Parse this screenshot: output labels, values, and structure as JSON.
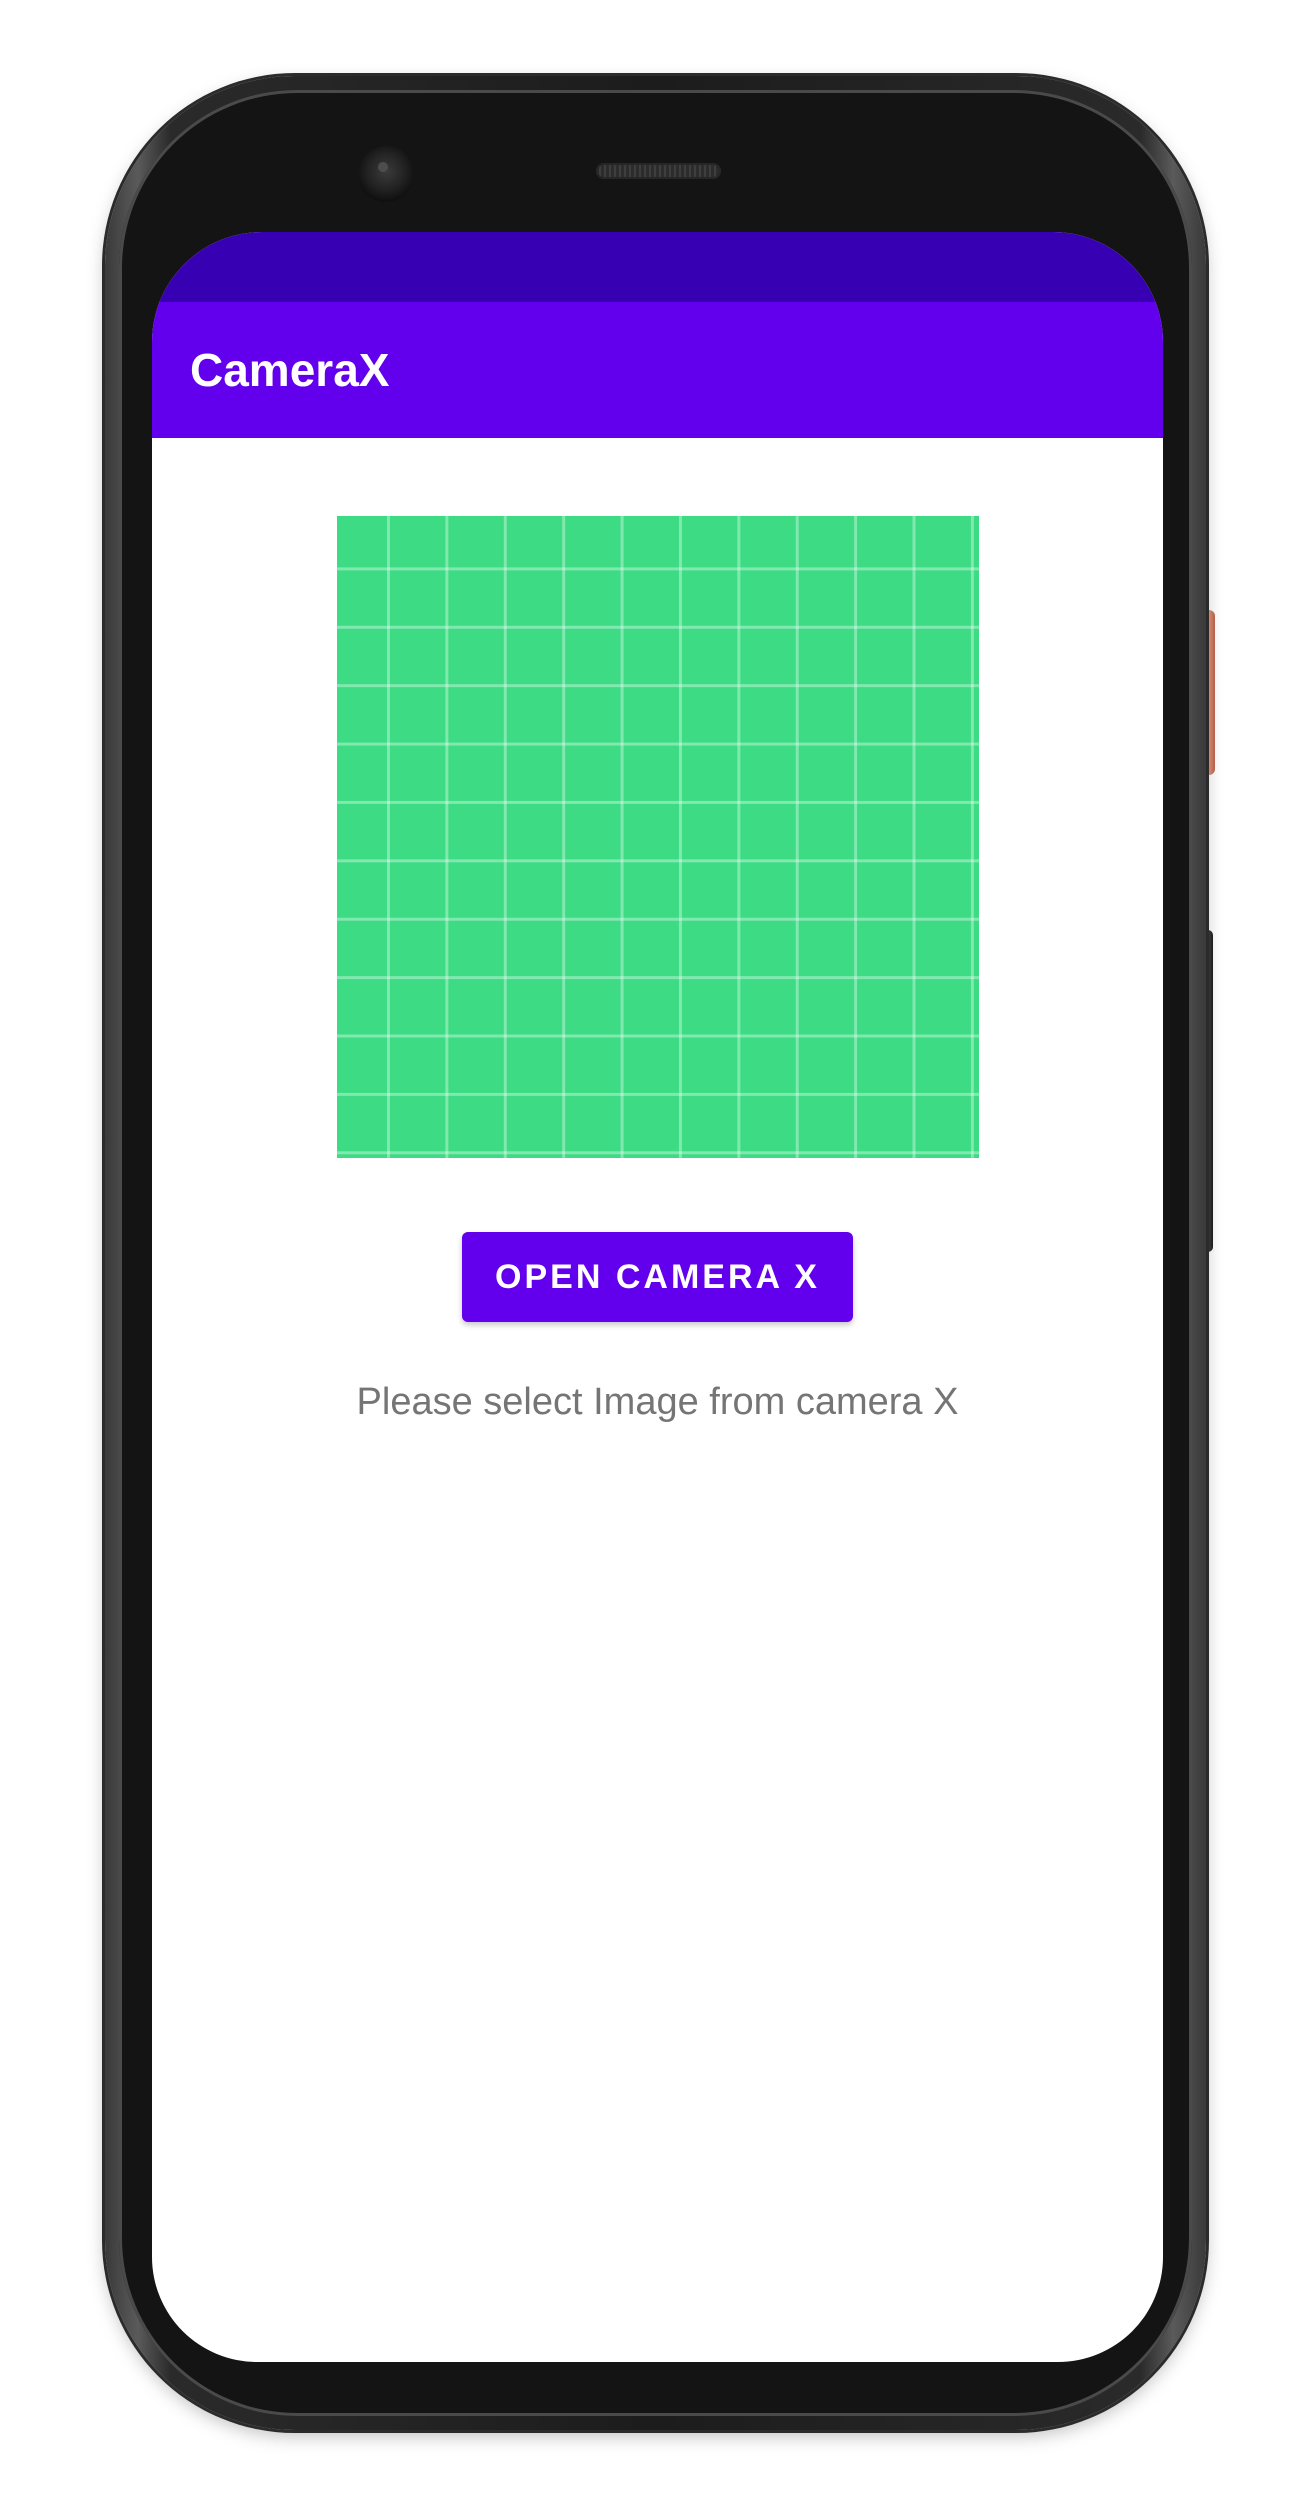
{
  "app_bar": {
    "title": "CameraX"
  },
  "main": {
    "image_placeholder_icon": "image-placeholder-grid",
    "open_camera_label": "OPEN CAMERA X",
    "hint_text": "Please select Image from camera X"
  },
  "colors": {
    "status_bar": "#3700B3",
    "primary": "#6200EE",
    "placeholder_green": "#3DDB84",
    "hint_text": "#757575",
    "power_button_accent": "#E8977F"
  }
}
